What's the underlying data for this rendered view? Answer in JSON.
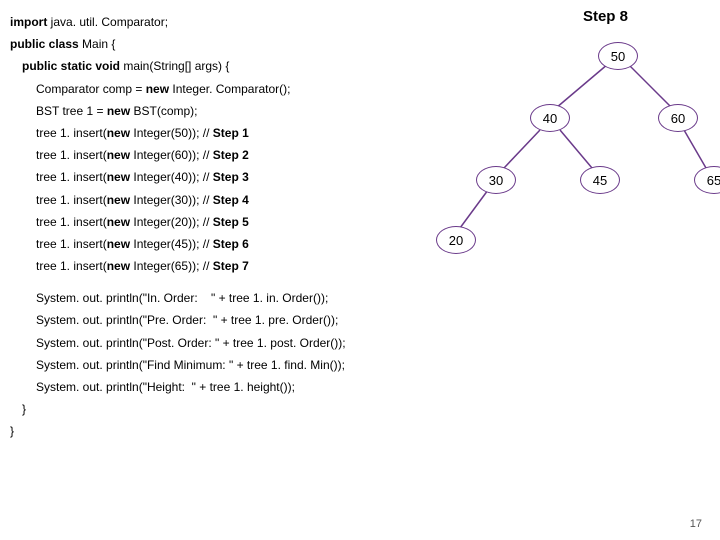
{
  "header": {
    "step_label": "Step",
    "step_number": "8"
  },
  "page_number": "17",
  "code": {
    "l01a": "import",
    "l01b": " java. util. Comparator;",
    "l02a": "public class",
    "l02b": " Main {",
    "l03a": "public static void",
    "l03b": " main(String[] args) {",
    "l04a": "Comparator comp = ",
    "l04b": "new",
    "l04c": " Integer. Comparator();",
    "l05a": "BST tree 1 = ",
    "l05b": "new",
    "l05c": " BST(comp);",
    "l06a": "tree 1. insert(",
    "l06b": "new",
    "l06c": " Integer(50)); ",
    "l06d": "// ",
    "l06e": "Step 1",
    "l07a": "tree 1. insert(",
    "l07b": "new",
    "l07c": " Integer(60)); ",
    "l07d": "// ",
    "l07e": "Step 2",
    "l08a": "tree 1. insert(",
    "l08b": "new",
    "l08c": " Integer(40)); ",
    "l08d": "// ",
    "l08e": "Step 3",
    "l09a": "tree 1. insert(",
    "l09b": "new",
    "l09c": " Integer(30)); ",
    "l09d": "// ",
    "l09e": "Step 4",
    "l10a": "tree 1. insert(",
    "l10b": "new",
    "l10c": " Integer(20)); ",
    "l10d": "// ",
    "l10e": "Step 5",
    "l11a": "tree 1. insert(",
    "l11b": "new",
    "l11c": " Integer(45)); ",
    "l11d": "// ",
    "l11e": "Step 6",
    "l12a": "tree 1. insert(",
    "l12b": "new",
    "l12c": " Integer(65)); ",
    "l12d": "// ",
    "l12e": "Step 7",
    "l13": "System. out. println(\"In. Order:    \" + tree 1. in. Order());",
    "l14": "System. out. println(\"Pre. Order:  \" + tree 1. pre. Order());",
    "l15": "System. out. println(\"Post. Order: \" + tree 1. post. Order());",
    "l16": "System. out. println(\"Find Minimum: \" + tree 1. find. Min());",
    "l17": "System. out. println(\"Height:  \" + tree 1. height());",
    "l18": "}",
    "l19": "}"
  },
  "tree": {
    "nodes": {
      "n50": "50",
      "n40": "40",
      "n60": "60",
      "n30": "30",
      "n45": "45",
      "n65": "65",
      "n20": "20"
    }
  }
}
